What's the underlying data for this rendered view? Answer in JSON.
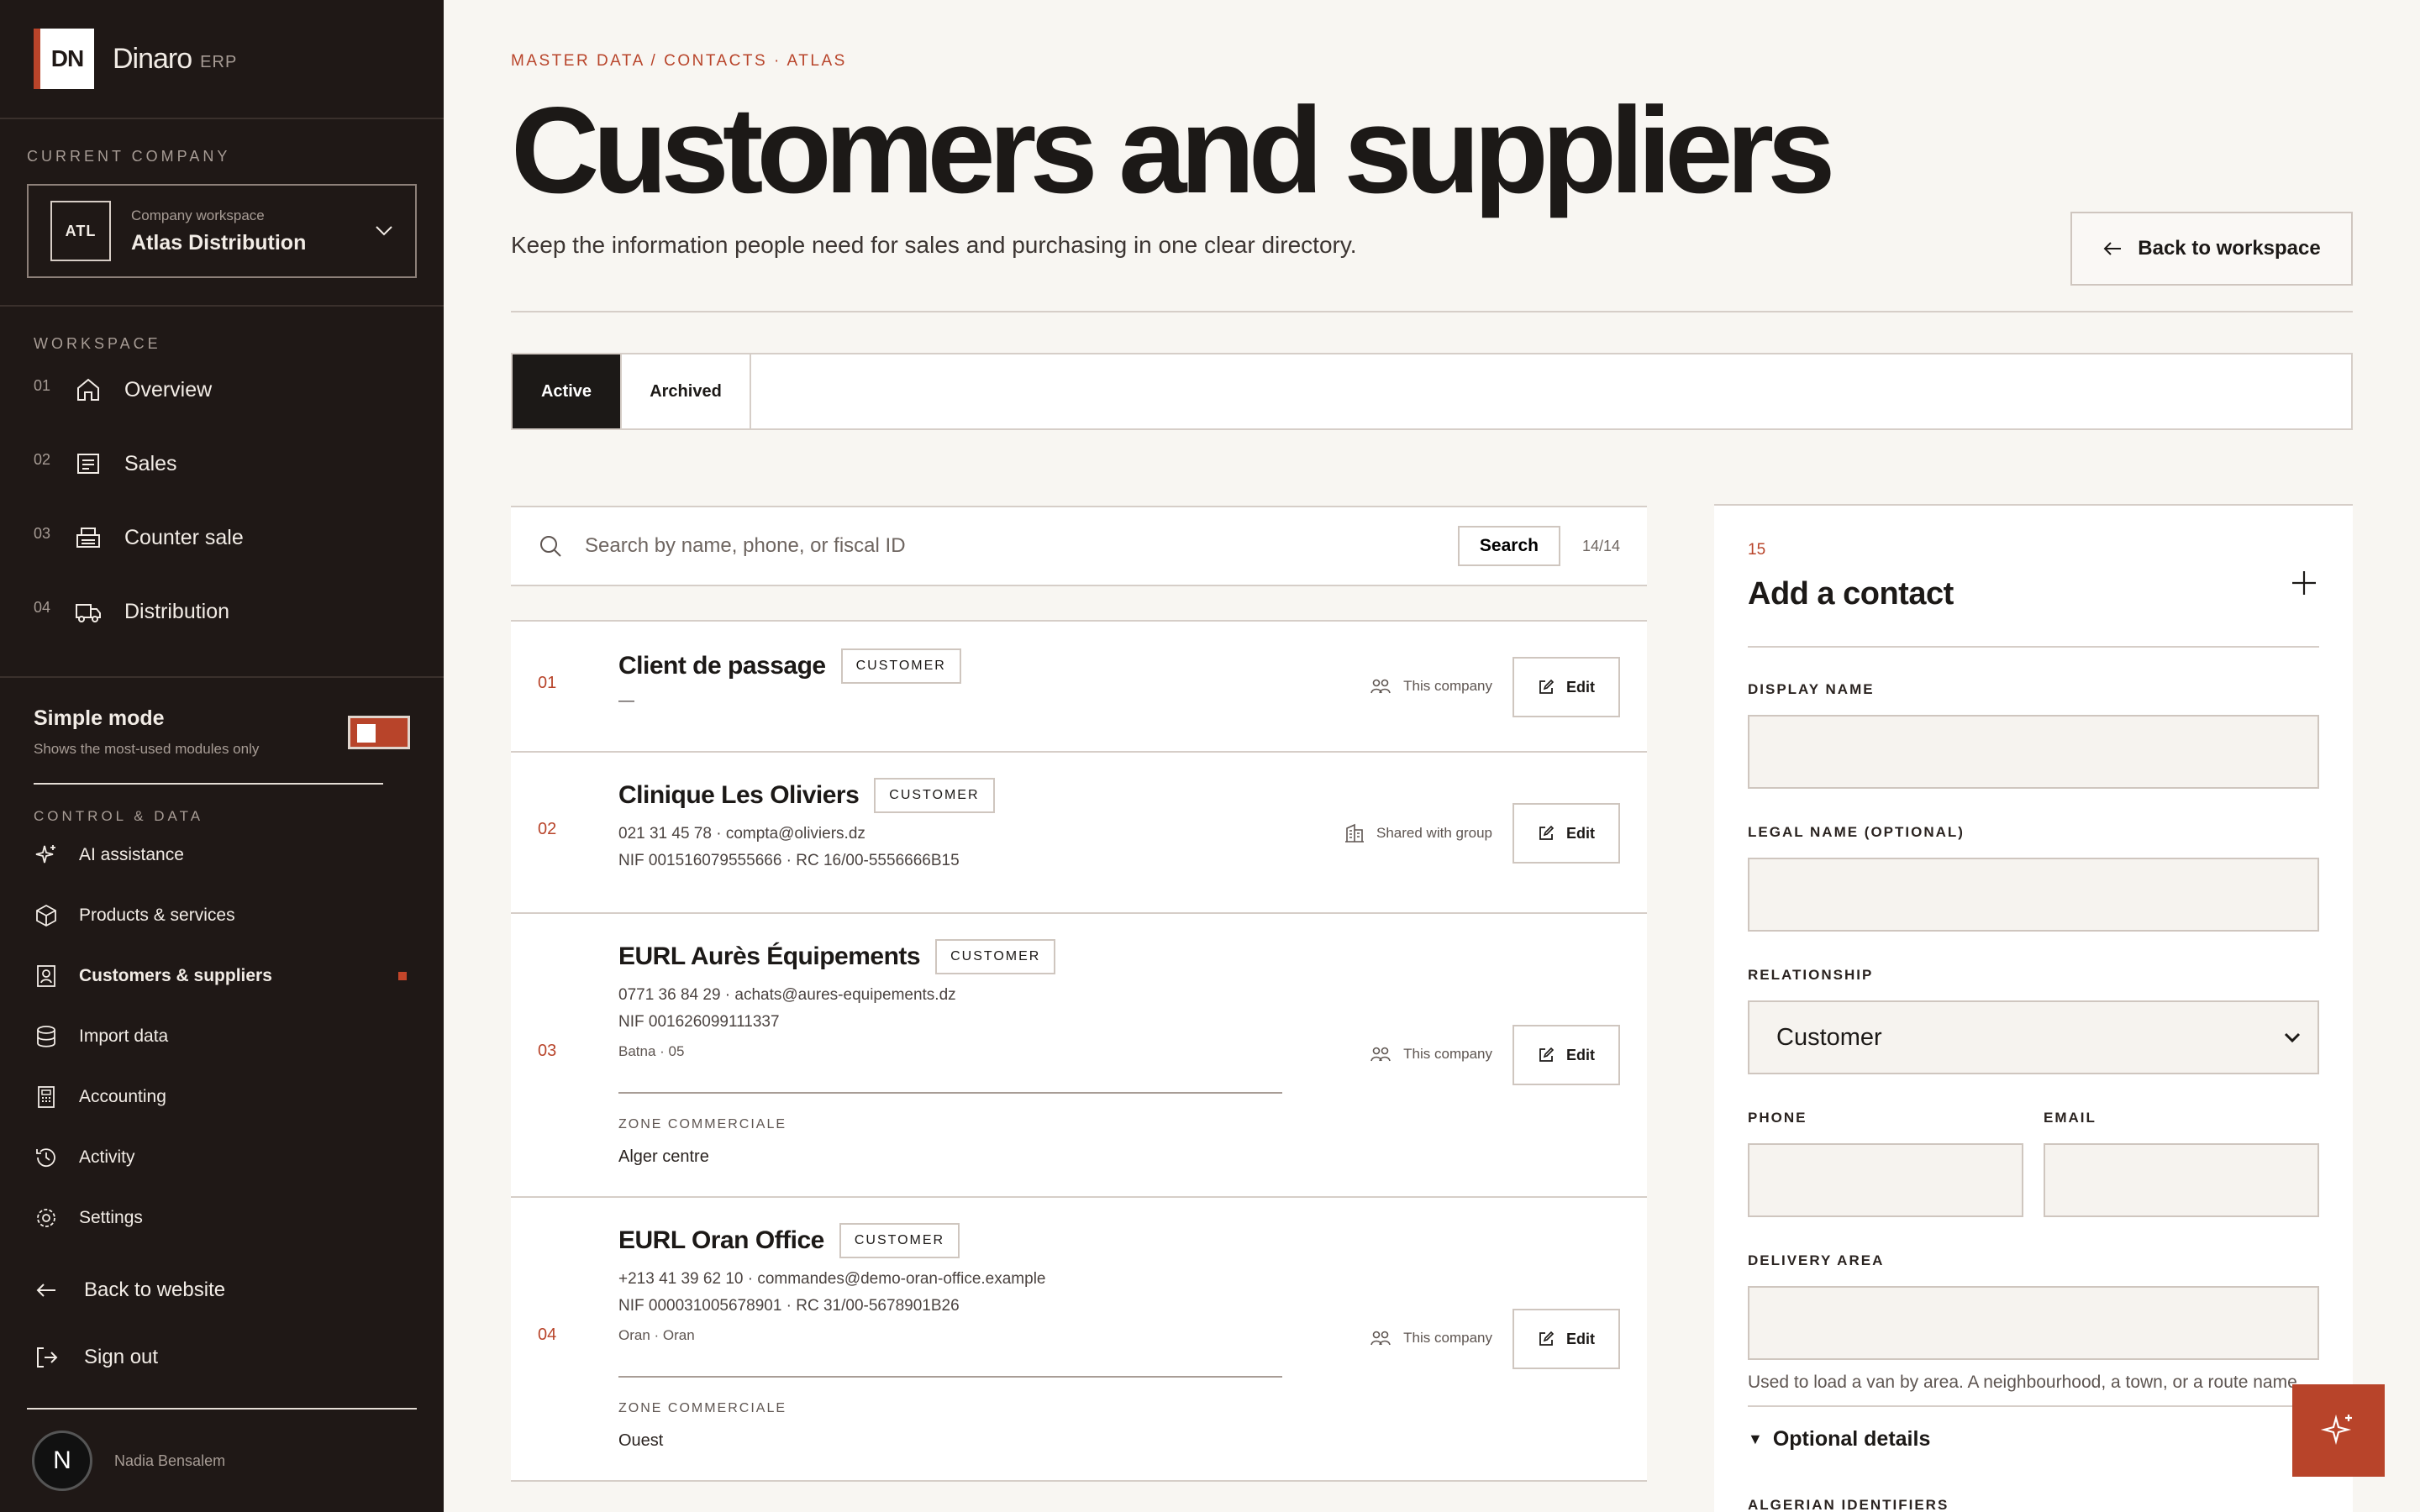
{
  "brand": {
    "logo": "DN",
    "name": "Dinaro",
    "sub": "ERP"
  },
  "company": {
    "section_label": "CURRENT COMPANY",
    "badge": "ATL",
    "caption": "Company workspace",
    "name": "Atlas Distribution"
  },
  "workspace": {
    "section_label": "WORKSPACE",
    "items": [
      {
        "num": "01",
        "label": "Overview",
        "icon": "home-icon"
      },
      {
        "num": "02",
        "label": "Sales",
        "icon": "receipt-icon"
      },
      {
        "num": "03",
        "label": "Counter sale",
        "icon": "register-icon"
      },
      {
        "num": "04",
        "label": "Distribution",
        "icon": "truck-icon"
      }
    ]
  },
  "simple_mode": {
    "title": "Simple mode",
    "subtitle": "Shows the most-used modules only",
    "enabled": true
  },
  "control": {
    "section_label": "CONTROL & DATA",
    "items": [
      {
        "label": "AI assistance",
        "icon": "sparkle-icon"
      },
      {
        "label": "Products & services",
        "icon": "box-icon"
      },
      {
        "label": "Customers & suppliers",
        "icon": "contacts-icon",
        "active": true
      },
      {
        "label": "Import data",
        "icon": "database-icon"
      },
      {
        "label": "Accounting",
        "icon": "calculator-icon"
      },
      {
        "label": "Activity",
        "icon": "history-icon"
      },
      {
        "label": "Settings",
        "icon": "gear-icon"
      }
    ]
  },
  "bottom_nav": {
    "back": "Back to website",
    "signout": "Sign out"
  },
  "user": {
    "initial": "N",
    "name": "Nadia Bensalem"
  },
  "header": {
    "breadcrumb": "MASTER DATA / CONTACTS · ATLAS",
    "title": "Customers and suppliers",
    "subtitle": "Keep the information people need for sales and purchasing in one clear directory.",
    "back_button": "Back to workspace"
  },
  "tabs": {
    "active": "Active",
    "archived": "Archived"
  },
  "search": {
    "placeholder": "Search by name, phone, or fiscal ID",
    "button": "Search",
    "count": "14/14"
  },
  "contacts": [
    {
      "num": "01",
      "name": "Client de passage",
      "badge": "CUSTOMER",
      "line1": "—",
      "line2": "",
      "line3": "",
      "share": "This company",
      "edit": "Edit"
    },
    {
      "num": "02",
      "name": "Clinique Les Oliviers",
      "badge": "CUSTOMER",
      "line1": "021 31 45 78 · compta@oliviers.dz",
      "line2": "NIF 001516079555666 · RC 16/00-5556666B15",
      "share": "Shared with group",
      "edit": "Edit"
    },
    {
      "num": "03",
      "name": "EURL Aurès Équipements",
      "badge": "CUSTOMER",
      "line1": "0771 36 84 29 · achats@aures-equipements.dz",
      "line2": "NIF 001626099111337",
      "line3": "Batna · 05",
      "zone_label": "ZONE COMMERCIALE",
      "zone": "Alger centre",
      "share": "This company",
      "edit": "Edit"
    },
    {
      "num": "04",
      "name": "EURL Oran Office",
      "badge": "CUSTOMER",
      "line1": "+213 41 39 62 10 · commandes@demo-oran-office.example",
      "line2": "NIF 000031005678901 · RC 31/00-5678901B26",
      "line3": "Oran · Oran",
      "zone_label": "ZONE COMMERCIALE",
      "zone": "Ouest",
      "share": "This company",
      "edit": "Edit"
    }
  ],
  "form": {
    "num": "15",
    "title": "Add a contact",
    "display_name_label": "DISPLAY NAME",
    "legal_name_label": "LEGAL NAME (OPTIONAL)",
    "relationship_label": "RELATIONSHIP",
    "relationship_value": "Customer",
    "phone_label": "PHONE",
    "email_label": "EMAIL",
    "delivery_label": "DELIVERY AREA",
    "delivery_help": "Used to load a van by area. A neighbourhood, a town, or a route name.",
    "optional": "Optional details",
    "next_section": "ALGERIAN IDENTIFIERS"
  },
  "colors": {
    "accent": "#b8442a",
    "sidebar": "#1f1816",
    "background": "#f8f6f2"
  }
}
